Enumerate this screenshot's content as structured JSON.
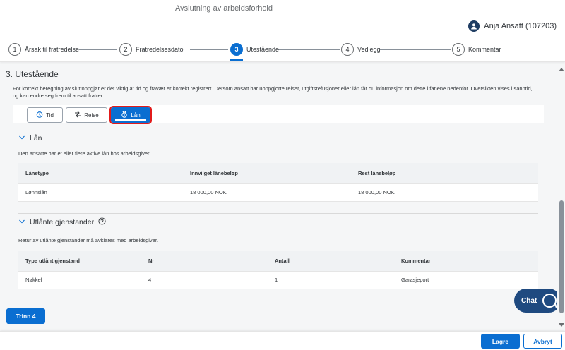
{
  "app": {
    "title": "Avslutning av arbeidsforhold"
  },
  "user": {
    "name": "Anja Ansatt (107203)"
  },
  "steps": [
    {
      "num": "1",
      "label": "Årsak til fratredelse"
    },
    {
      "num": "2",
      "label": "Fratredelsesdato"
    },
    {
      "num": "3",
      "label": "Utestående"
    },
    {
      "num": "4",
      "label": "Vedlegg"
    },
    {
      "num": "5",
      "label": "Kommentar"
    }
  ],
  "section": {
    "title": "3. Utestående",
    "intro": "For korrekt beregning av sluttoppgjør er det viktig at tid og fravær er korrekt registrert. Dersom ansatt har uoppgjorte reiser, utgiftsrefusjoner eller lån får du informasjon om dette i fanene nedenfor. Oversikten vises i sanntid, og kan endre seg frem til ansatt fratrer."
  },
  "tabs": [
    {
      "label": "Tid",
      "icon": "time-icon"
    },
    {
      "label": "Reise",
      "icon": "travel-icon"
    },
    {
      "label": "Lån",
      "icon": "money-bills-icon"
    }
  ],
  "loan": {
    "heading": "Lån",
    "desc": "Den ansatte har et eller flere aktive lån hos arbeidsgiver.",
    "columns": [
      "Lånetype",
      "Innvilget lånebeløp",
      "Rest lånebeløp"
    ],
    "rows": [
      [
        "Lønnslån",
        "18 000,00 NOK",
        "18 000,00 NOK"
      ]
    ]
  },
  "items": {
    "heading": "Utlånte gjenstander",
    "desc": "Retur av utlånte gjenstander må avklares med arbeidsgiver.",
    "columns": [
      "Type utlånt gjenstand",
      "Nr",
      "Antall",
      "Kommentar"
    ],
    "rows": [
      [
        "Nøkkel",
        "4",
        "1",
        "Garasjeport"
      ]
    ]
  },
  "actions": {
    "trinn": "Trinn 4",
    "save": "Lagre",
    "cancel": "Avbryt",
    "chat": "Chat"
  },
  "colors": {
    "accent": "#0a6ed1",
    "highlight": "#e21b1b",
    "chat": "#1f4a80"
  }
}
